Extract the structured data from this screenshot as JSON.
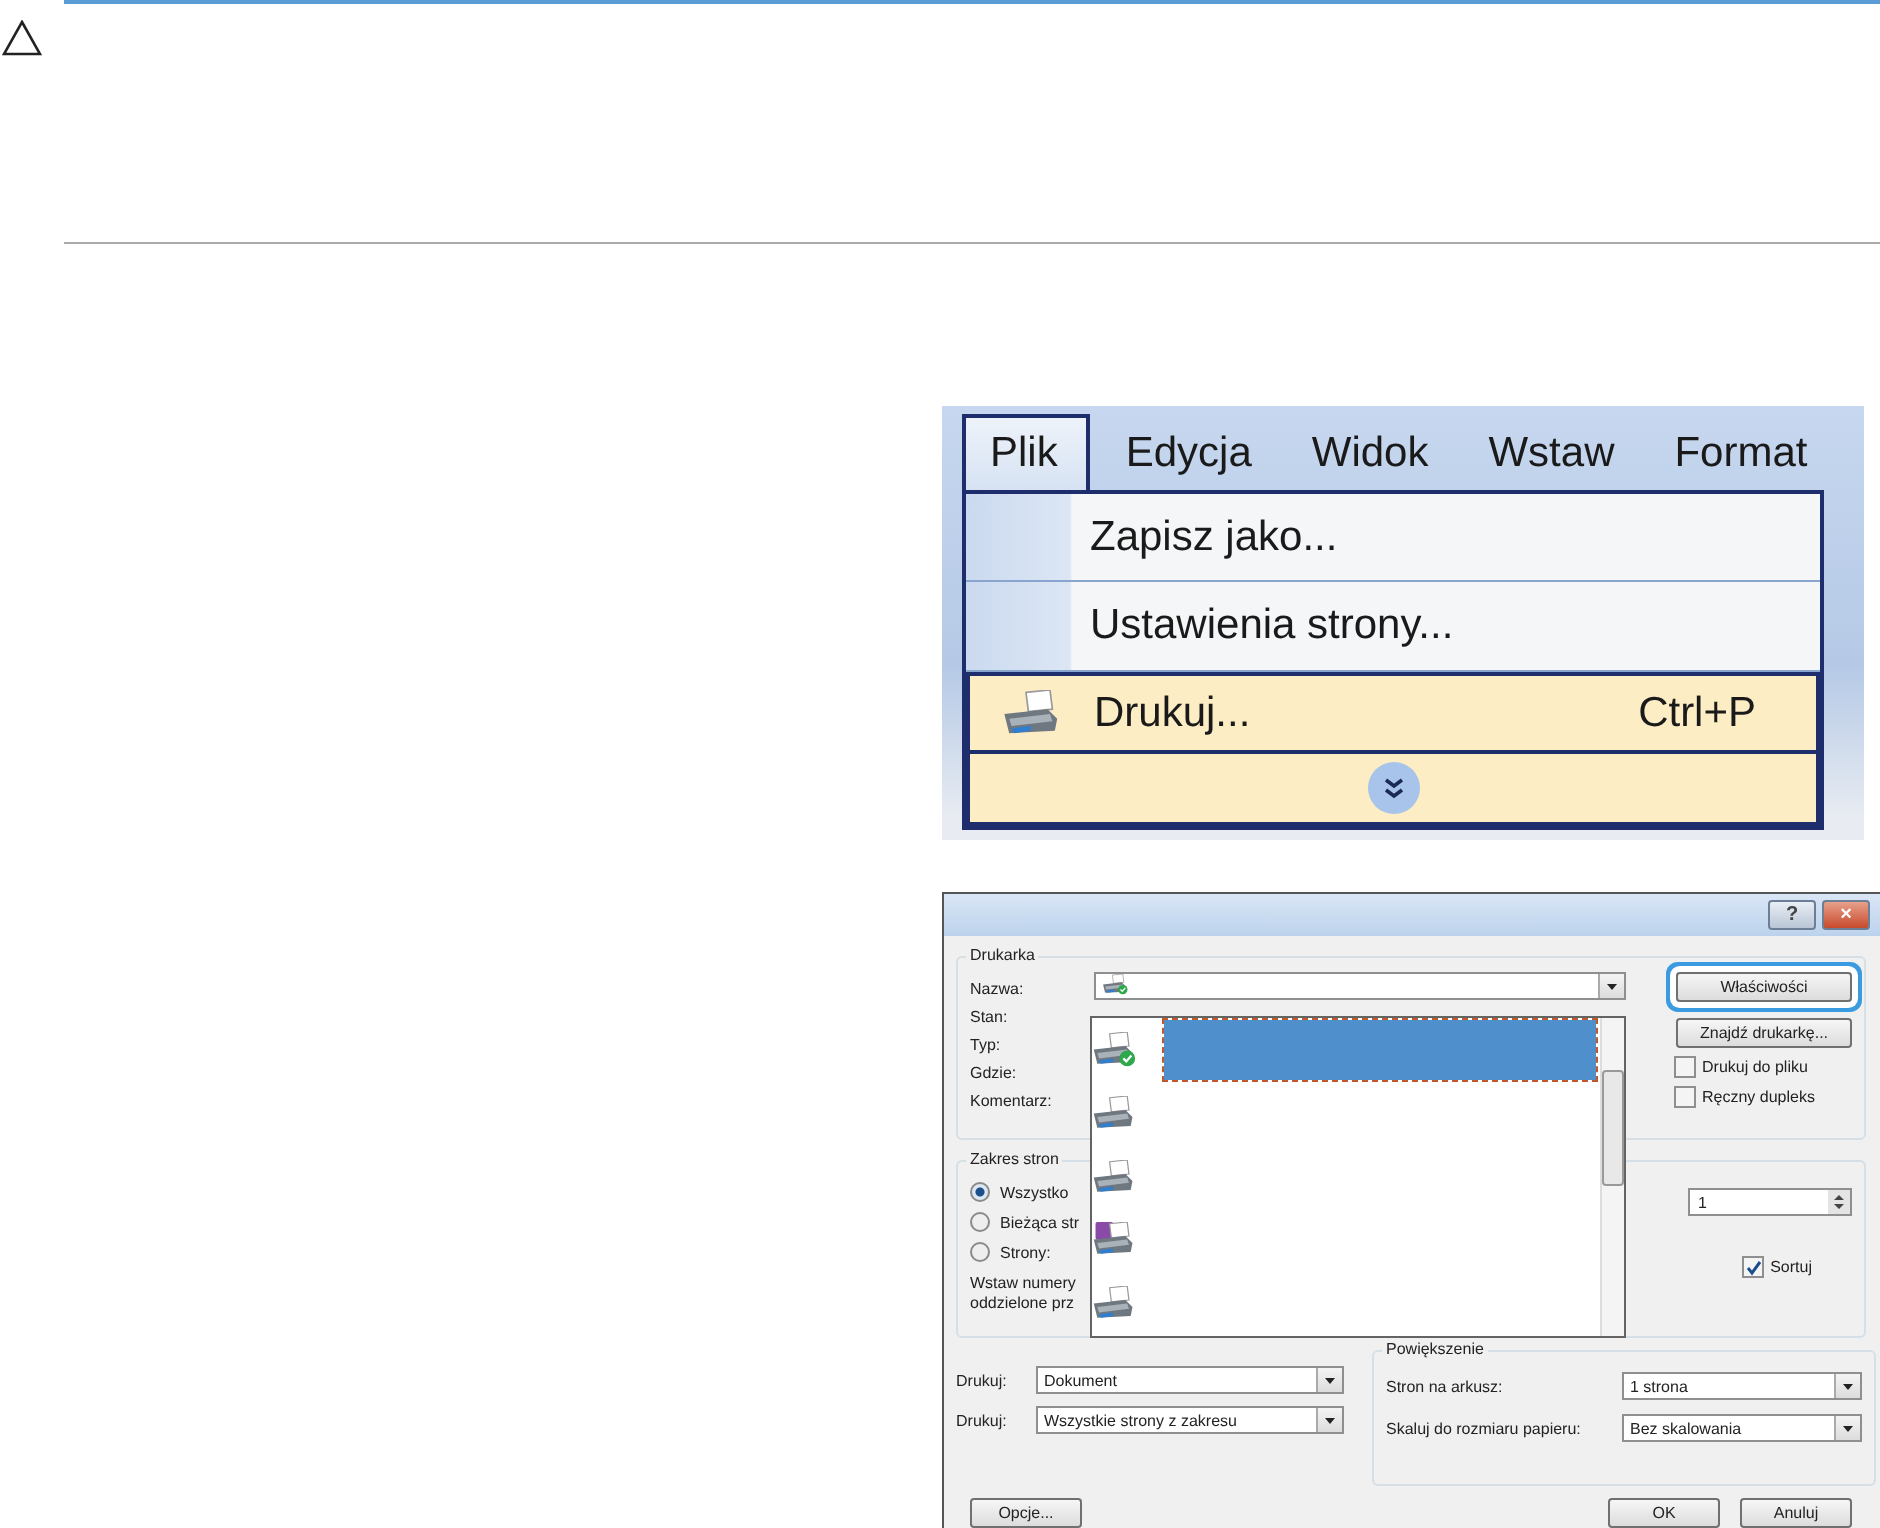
{
  "menu_screenshot": {
    "menubar": [
      {
        "label": "Plik",
        "selected": true
      },
      {
        "label": "Edycja",
        "selected": false
      },
      {
        "label": "Widok",
        "selected": false
      },
      {
        "label": "Wstaw",
        "selected": false
      },
      {
        "label": "Format",
        "selected": false
      }
    ],
    "menu_items": [
      {
        "label": "Zapisz jako...",
        "selected": false
      },
      {
        "label": "Ustawienia strony...",
        "selected": false
      },
      {
        "label": "Drukuj...",
        "shortcut": "Ctrl+P",
        "selected": true
      }
    ]
  },
  "print_dialog": {
    "window_buttons": [
      {
        "kind": "help",
        "glyph": "?"
      },
      {
        "kind": "close",
        "glyph": "×"
      }
    ],
    "printer_group": {
      "title": "Drukarka",
      "labels": [
        "Nazwa:",
        "Stan:",
        "Typ:",
        "Gdzie:",
        "Komentarz:"
      ],
      "buttons": [
        {
          "label": "Właściwości",
          "focused": true
        },
        {
          "label": "Znajdź drukarkę...",
          "focused": false
        }
      ],
      "checkboxes": [
        {
          "label": "Drukuj do pliku",
          "checked": false
        },
        {
          "label": "Ręczny dupleks",
          "checked": false
        }
      ]
    },
    "printer_list": [
      {
        "kind": "default",
        "selected": true
      },
      {
        "kind": "plain",
        "selected": false
      },
      {
        "kind": "plain",
        "selected": false
      },
      {
        "kind": "file",
        "selected": false
      },
      {
        "kind": "plain",
        "selected": false
      }
    ],
    "range_group": {
      "title": "Zakres stron",
      "options": [
        {
          "label": "Wszystko",
          "selected": true
        },
        {
          "label": "Bieżąca str",
          "selected": false
        },
        {
          "label": "Strony:",
          "selected": false
        }
      ],
      "hint_lines": [
        "Wstaw numery",
        "oddzielone prz"
      ]
    },
    "copies": {
      "value": "1"
    },
    "collate": {
      "label": "Sortuj",
      "checked": true
    },
    "print_what": [
      {
        "label": "Drukuj:",
        "value": "Dokument"
      },
      {
        "label": "Drukuj:",
        "value": "Wszystkie strony z zakresu"
      }
    ],
    "zoom_group": {
      "title": "Powiększenie",
      "rows": [
        {
          "label": "Stron na arkusz:",
          "value": "1 strona"
        },
        {
          "label": "Skaluj do rozmiaru papieru:",
          "value": "Bez skalowania"
        }
      ]
    },
    "buttons": [
      "Opcje...",
      "OK",
      "Anuluj"
    ]
  }
}
